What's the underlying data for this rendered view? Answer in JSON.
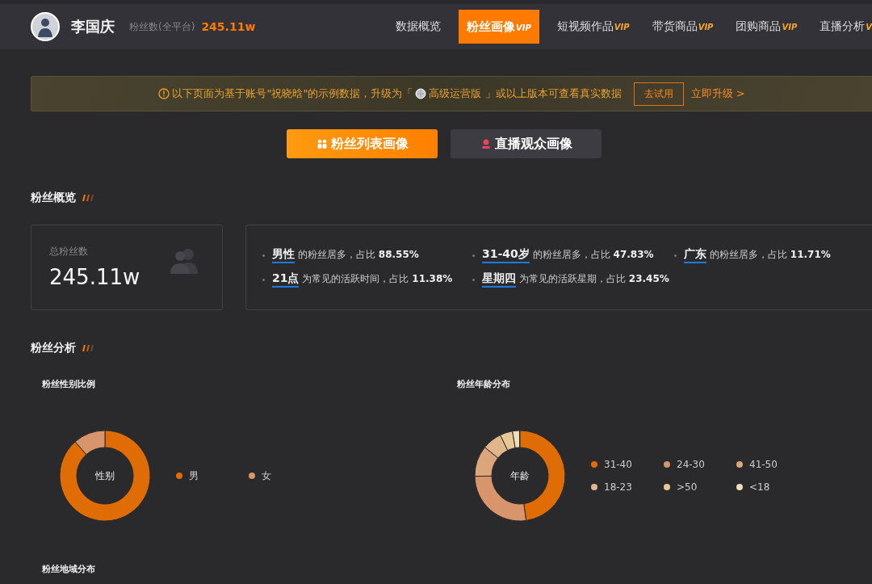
{
  "header": {
    "name": "李国庆",
    "fans_label": "粉丝数(全平台)",
    "fans_value": "245.11w"
  },
  "nav": [
    {
      "label": "数据概览",
      "selected": false
    },
    {
      "label": "粉丝画像",
      "badge": "VIP",
      "selected": true
    },
    {
      "label": "短视频作品",
      "badge": "VIP",
      "selected": false
    },
    {
      "label": "带货商品",
      "badge": "VIP",
      "selected": false
    },
    {
      "label": "团购商品",
      "badge": "VIP",
      "selected": false
    },
    {
      "label": "直播分析",
      "badge": "V",
      "selected": false
    }
  ],
  "notice": {
    "text_before": "以下页面为基于账号\"祝晓晗\"的示例数据，升级为「",
    "text_after": "高级运营版 」或以上版本可查看真实数据",
    "try_button": "去试用",
    "upgrade_link": "立即升级 >"
  },
  "portrait_tabs": [
    {
      "label": "粉丝列表画像",
      "kind": "fans",
      "selected": true
    },
    {
      "label": "直播观众画像",
      "kind": "live",
      "selected": false
    }
  ],
  "overview": {
    "title": "粉丝概览",
    "total_label": "总粉丝数",
    "total_value": "245.11w",
    "facts": [
      {
        "key": "男性",
        "text": "的粉丝居多，占比 **88.55%**"
      },
      {
        "key": "31-40岁",
        "text": "的粉丝居多，占比 **47.83%**"
      },
      {
        "key": "广东",
        "text": "的粉丝居多，占比 **11.71%**"
      },
      {
        "key": "21点",
        "text": "为常见的活跃时间，占比 **11.38%**"
      },
      {
        "key": "星期四",
        "text": "为常见的活跃星期，占比 **23.45%**"
      }
    ]
  },
  "analysis": {
    "title": "粉丝分析",
    "gender": {
      "title": "粉丝性别比例",
      "center": "性别",
      "legend": [
        {
          "label": "男",
          "color": "#e06c06"
        },
        {
          "label": "女",
          "color": "#d8946a"
        }
      ]
    },
    "age": {
      "title": "粉丝年龄分布",
      "center": "年龄",
      "legend": [
        {
          "label": "31-40",
          "color": "#e06c06"
        },
        {
          "label": "24-30",
          "color": "#d8946a"
        },
        {
          "label": "41-50",
          "color": "#dca57c"
        },
        {
          "label": "18-23",
          "color": "#e0b78a"
        },
        {
          "label": ">50",
          "color": "#e6c796"
        },
        {
          "label": "<18",
          "color": "#efdcb8"
        }
      ]
    },
    "region_title": "粉丝地域分布"
  }
}
